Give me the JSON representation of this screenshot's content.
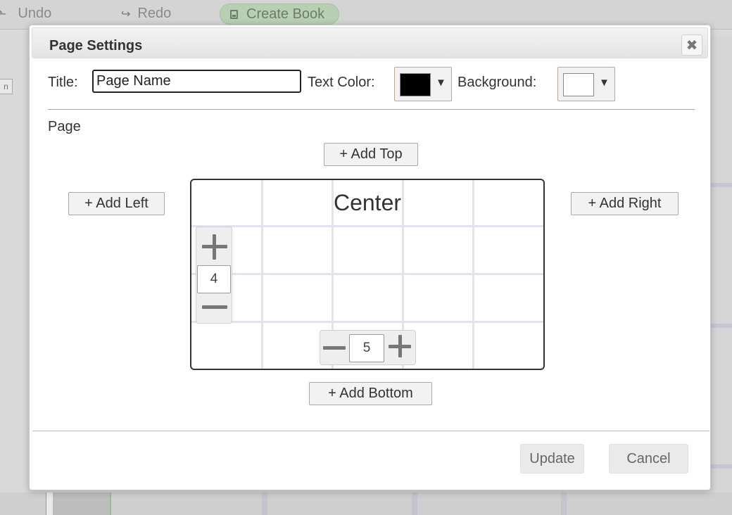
{
  "toolbar": {
    "undo_label": "Undo",
    "redo_label": "Redo",
    "create_book_label": "Create Book",
    "undo_icon": "undo-arrow-icon",
    "redo_icon": "redo-arrow-icon",
    "book_icon": "book-icon"
  },
  "background": {
    "side_button_label": "n"
  },
  "dialog": {
    "title": "Page Settings",
    "close_icon": "close-icon",
    "title_label": "Title:",
    "title_value": "Page Name",
    "text_color_label": "Text Color:",
    "text_color": "#000000",
    "background_label": "Background:",
    "background_color": "#ffffff",
    "dropdown_arrow": "▼",
    "page_section_label": "Page",
    "add_top_label": "+ Add Top",
    "add_left_label": "+ Add Left",
    "add_right_label": "+ Add Right",
    "add_bottom_label": "+ Add Bottom",
    "center_label": "Center",
    "rows_value": "4",
    "columns_value": "5",
    "update_label": "Update",
    "cancel_label": "Cancel"
  },
  "colors": {
    "grid_line": "#e3e2ee",
    "create_book_bg": "#b9cfb3"
  }
}
